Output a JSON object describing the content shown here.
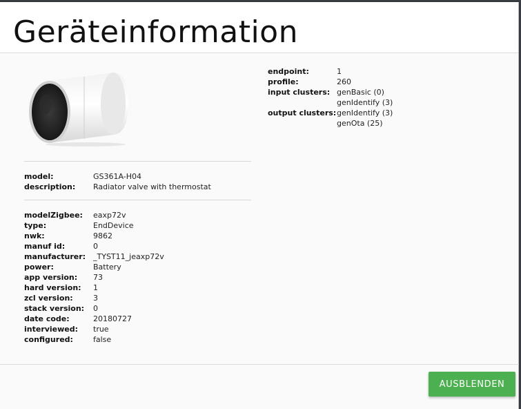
{
  "modal": {
    "title": "Geräteinformation",
    "button_label": "AUSBLENDEN"
  },
  "device_image": {
    "icon": "radiator-valve-thermostat-image"
  },
  "identity": [
    {
      "key": "model:",
      "value": "GS361A-H04",
      "is_link": true
    },
    {
      "key": "description:",
      "value": "Radiator valve with thermostat"
    }
  ],
  "details": [
    {
      "key": "modelZigbee:",
      "value": "eaxp72v"
    },
    {
      "key": "type:",
      "value": "EndDevice"
    },
    {
      "key": "nwk:",
      "value": "9862"
    },
    {
      "key": "manuf id:",
      "value": "0"
    },
    {
      "key": "manufacturer:",
      "value": "_TYST11_jeaxp72v"
    },
    {
      "key": "power:",
      "value": "Battery"
    },
    {
      "key": "app version:",
      "value": "73"
    },
    {
      "key": "hard version:",
      "value": "1"
    },
    {
      "key": "zcl version:",
      "value": "3"
    },
    {
      "key": "stack version:",
      "value": "0"
    },
    {
      "key": "date code:",
      "value": "20180727"
    },
    {
      "key": "interviewed:",
      "value": "true"
    },
    {
      "key": "configured:",
      "value": "false"
    }
  ],
  "endpoint": [
    {
      "key": "endpoint:",
      "value": "1"
    },
    {
      "key": "profile:",
      "value": "260"
    },
    {
      "key": "input clusters:",
      "value": "genBasic (0)"
    },
    {
      "key": "",
      "value": "genIdentify (3)"
    },
    {
      "key": "output clusters:",
      "value": "genIdentify (3)"
    },
    {
      "key": "",
      "value": "genOta (25)"
    }
  ],
  "colors": {
    "accent": "#4caf50",
    "link": "#2a7abf"
  }
}
